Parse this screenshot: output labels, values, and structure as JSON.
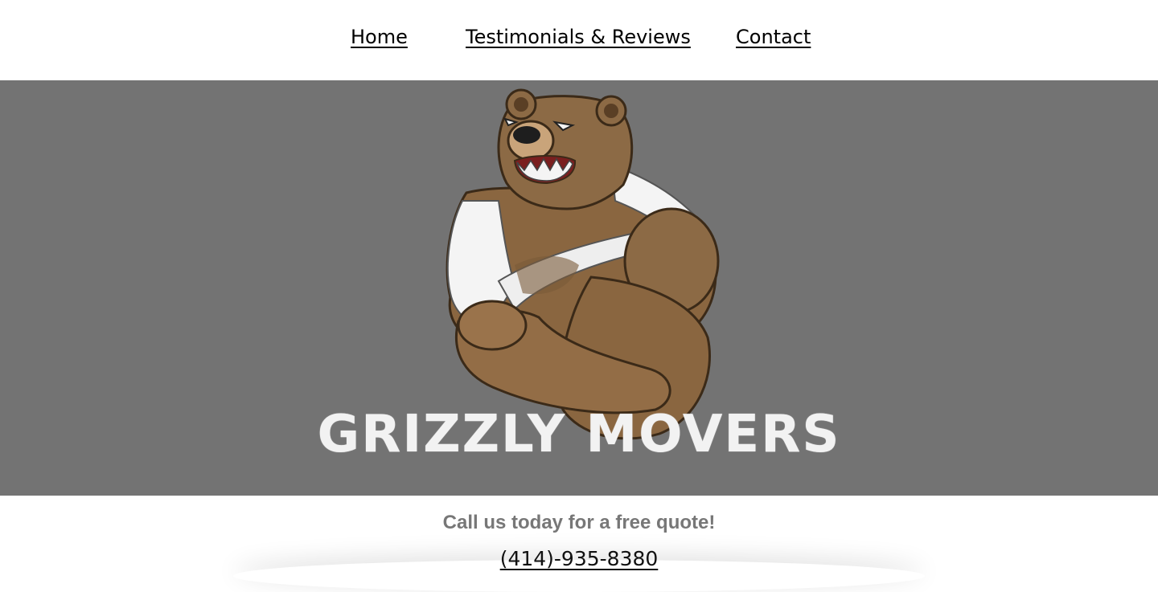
{
  "nav": {
    "items": [
      {
        "label": "Home"
      },
      {
        "label": "Testimonials & Reviews"
      },
      {
        "label": "Contact"
      }
    ]
  },
  "hero": {
    "logo_text": "GRIZZLY MOVERS",
    "background_color": "#737373",
    "mascot_icon": "grizzly-bear-mascot"
  },
  "cta": {
    "title": "Call us today for a free quote!",
    "phone": "(414)-935-8380"
  }
}
